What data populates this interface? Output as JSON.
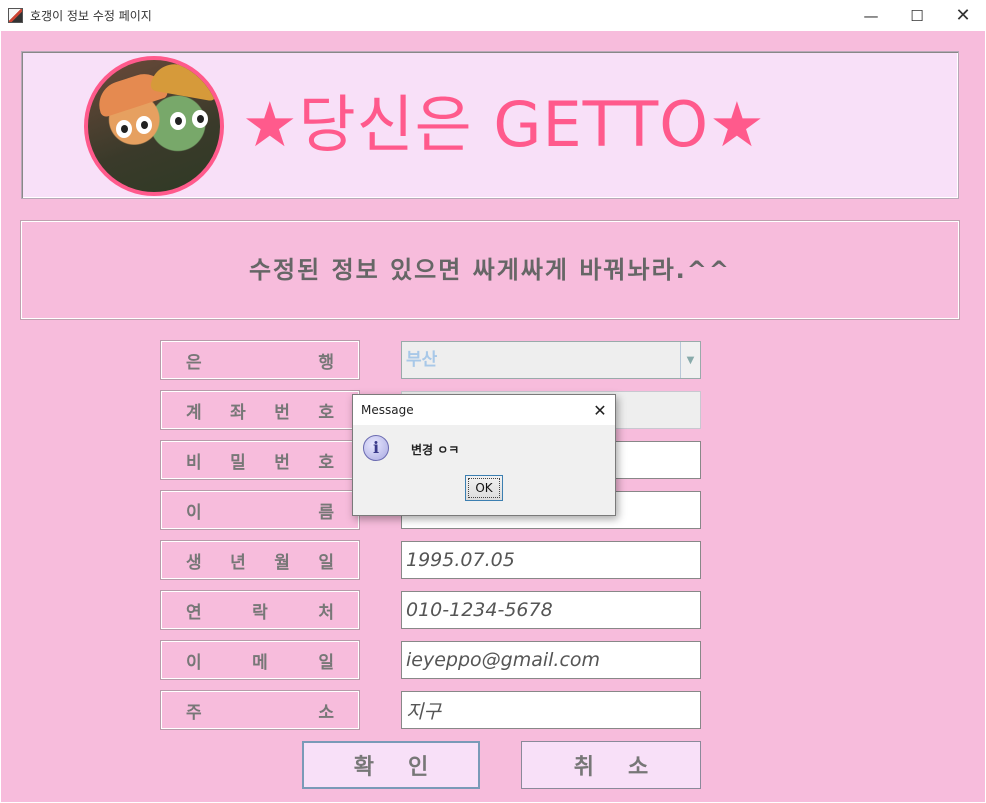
{
  "window": {
    "title": "호갱이 정보 수정 페이지",
    "minimize": "—",
    "maximize": "☐",
    "close": "✕"
  },
  "banner": {
    "title": "★당신은 GETTO★"
  },
  "message": "수정된 정보 있으면 싸게싸게 바꿔놔라.^^",
  "form": {
    "bank_label": [
      "은",
      "행"
    ],
    "bank_value": "부산",
    "account_label": [
      "계",
      "좌",
      "번",
      "호"
    ],
    "account_value": "",
    "password_label": [
      "비",
      "밀",
      "번",
      "호"
    ],
    "password_value": "",
    "name_label": [
      "이",
      "름"
    ],
    "name_value": "",
    "birth_label": [
      "생",
      "년",
      "월",
      "일"
    ],
    "birth_value": "1995.07.05",
    "phone_label": [
      "연",
      "락",
      "처"
    ],
    "phone_value": "010-1234-5678",
    "email_label": [
      "이",
      "메",
      "일"
    ],
    "email_value": "ieyeppo@gmail.com",
    "address_label": [
      "주",
      "소"
    ],
    "address_value": "지구"
  },
  "buttons": {
    "confirm": "확인",
    "cancel": "취소"
  },
  "dialog": {
    "title": "Message",
    "close": "✕",
    "icon": "info-icon",
    "icon_glyph": "i",
    "text": "변경 ㅇㅋ",
    "ok": "OK"
  },
  "colors": {
    "background": "#f7bcdc",
    "banner": "#f8e0f8",
    "accent": "#ff5a8c"
  }
}
